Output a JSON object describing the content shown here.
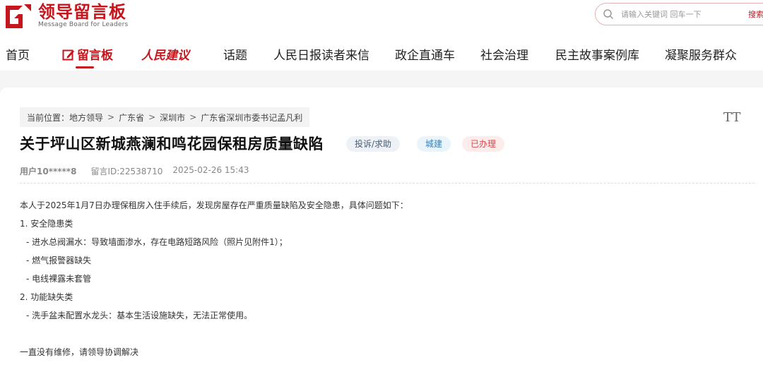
{
  "header": {
    "logo_cn": "领导留言板",
    "logo_en": "Message Board for Leaders",
    "search_placeholder": "请输入关键词 回车一下",
    "search_button": "搜索"
  },
  "nav": {
    "items": [
      "首页",
      "留言板",
      "人民建议",
      "话题",
      "人民日报读者来信",
      "政企直通车",
      "社会治理",
      "民主故事案例库",
      "凝聚服务群众"
    ]
  },
  "breadcrumb": {
    "prefix": "当前位置：",
    "items": [
      "地方领导",
      "广东省",
      "深圳市",
      "广东省深圳市委书记孟凡利"
    ],
    "separator": ">"
  },
  "font_toggle": "TT",
  "post": {
    "title": "关于坪山区新城燕澜和鸣花园保租房质量缺陷",
    "tags": [
      "投诉/求助",
      "城建",
      "已办理"
    ],
    "user": "用户10*****8",
    "message_id": "留言ID:22538710",
    "datetime": "2025-02-26 15:43",
    "body": [
      "本人于2025年1月7日办理保租房入住手续后，发现房屋存在严重质量缺陷及安全隐患，具体问题如下：",
      "1. 安全隐患类",
      "   - 进水总阀漏水：导致墙面渗水，存在电路短路风险（照片见附件1）；",
      "   - 燃气报警器缺失",
      "   - 电线裸露未套管",
      "2. 功能缺失类",
      "   - 洗手盆未配置水龙头：基本生活设施缺失，无法正常使用。",
      "",
      "一直没有维修，请领导协调解决"
    ]
  },
  "colors": {
    "brand_red": "#c4161c",
    "tag_type_bg": "#eef1f5",
    "tag_domain_bg": "#eaf4fb",
    "tag_status_bg": "#fdecec"
  },
  "icons": [
    "logo-mark-icon",
    "search-icon",
    "message-board-icon"
  ]
}
